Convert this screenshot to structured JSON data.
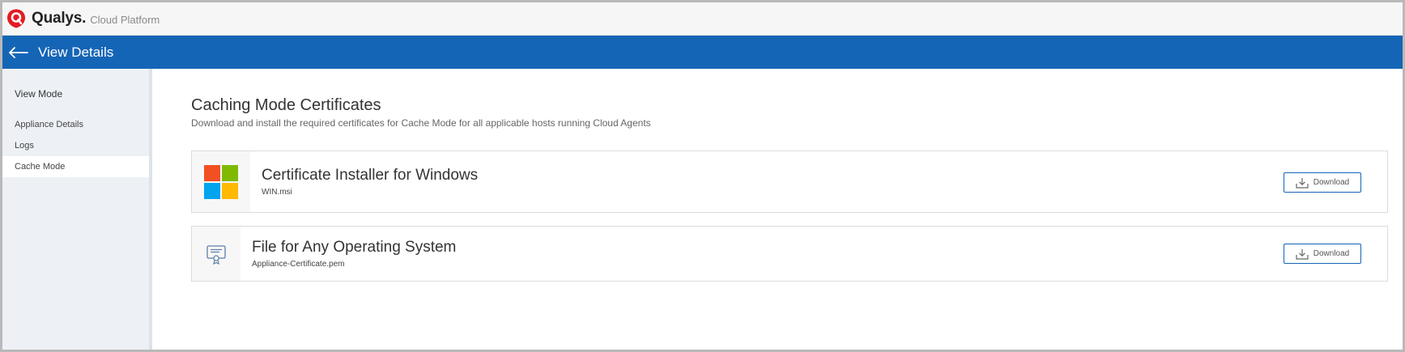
{
  "app": {
    "brand": "Qualys.",
    "brand_sub": "Cloud Platform",
    "accent_color": "#1565b6",
    "logo_color": "#e31b23"
  },
  "header": {
    "title": "View Details",
    "back_icon": "arrow-left-icon"
  },
  "sidebar": {
    "heading": "View Mode",
    "items": [
      {
        "label": "Appliance Details",
        "active": false
      },
      {
        "label": "Logs",
        "active": false
      },
      {
        "label": "Cache Mode",
        "active": true
      }
    ]
  },
  "main": {
    "title": "Caching Mode Certificates",
    "subtitle": "Download and install the required certificates for Cache Mode for all applicable hosts running Cloud Agents",
    "cards": [
      {
        "title": "Certificate Installer for Windows",
        "file": "WIN.msi",
        "icon": "windows-logo-icon",
        "button_label": "Download"
      },
      {
        "title": "File for Any Operating System",
        "file": "Appliance-Certificate.pem",
        "icon": "certificate-icon",
        "button_label": "Download"
      }
    ]
  }
}
